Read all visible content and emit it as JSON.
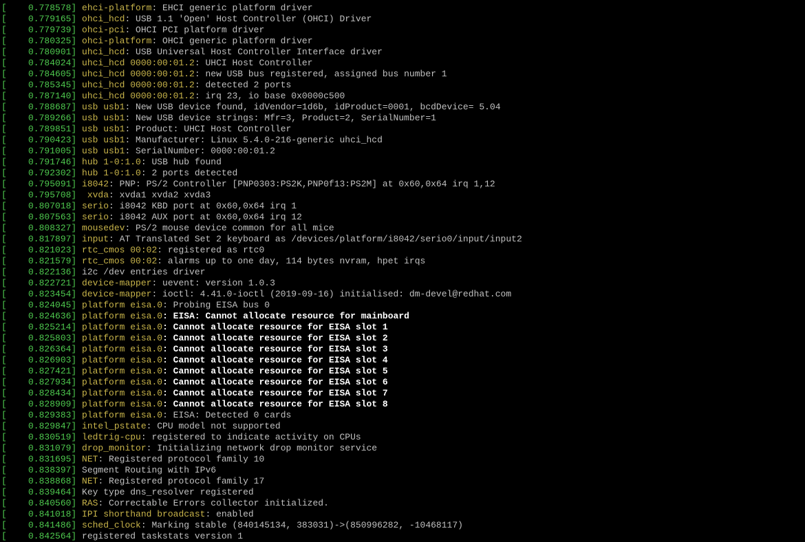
{
  "colors": {
    "background": "#000000",
    "timestamp": "#4ec94e",
    "subsystem": "#c8b44a",
    "message": "#c0c0c0",
    "warning": "#ffffff"
  },
  "lines": [
    {
      "ts": "[    0.778578] ",
      "sub": "ehci-platform",
      "msg": ": EHCI generic platform driver",
      "bold": false
    },
    {
      "ts": "[    0.779165] ",
      "sub": "ohci_hcd",
      "msg": ": USB 1.1 'Open' Host Controller (OHCI) Driver",
      "bold": false
    },
    {
      "ts": "[    0.779739] ",
      "sub": "ohci-pci",
      "msg": ": OHCI PCI platform driver",
      "bold": false
    },
    {
      "ts": "[    0.780325] ",
      "sub": "ohci-platform",
      "msg": ": OHCI generic platform driver",
      "bold": false
    },
    {
      "ts": "[    0.780901] ",
      "sub": "uhci_hcd",
      "msg": ": USB Universal Host Controller Interface driver",
      "bold": false
    },
    {
      "ts": "[    0.784024] ",
      "sub": "uhci_hcd 0000:00:01.2",
      "msg": ": UHCI Host Controller",
      "bold": false
    },
    {
      "ts": "[    0.784605] ",
      "sub": "uhci_hcd 0000:00:01.2",
      "msg": ": new USB bus registered, assigned bus number 1",
      "bold": false
    },
    {
      "ts": "[    0.785345] ",
      "sub": "uhci_hcd 0000:00:01.2",
      "msg": ": detected 2 ports",
      "bold": false
    },
    {
      "ts": "[    0.787140] ",
      "sub": "uhci_hcd 0000:00:01.2",
      "msg": ": irq 23, io base 0x0000c500",
      "bold": false
    },
    {
      "ts": "[    0.788687] ",
      "sub": "usb usb1",
      "msg": ": New USB device found, idVendor=1d6b, idProduct=0001, bcdDevice= 5.04",
      "bold": false
    },
    {
      "ts": "[    0.789266] ",
      "sub": "usb usb1",
      "msg": ": New USB device strings: Mfr=3, Product=2, SerialNumber=1",
      "bold": false
    },
    {
      "ts": "[    0.789851] ",
      "sub": "usb usb1",
      "msg": ": Product: UHCI Host Controller",
      "bold": false
    },
    {
      "ts": "[    0.790423] ",
      "sub": "usb usb1",
      "msg": ": Manufacturer: Linux 5.4.0-216-generic uhci_hcd",
      "bold": false
    },
    {
      "ts": "[    0.791005] ",
      "sub": "usb usb1",
      "msg": ": SerialNumber: 0000:00:01.2",
      "bold": false
    },
    {
      "ts": "[    0.791746] ",
      "sub": "hub 1-0:1.0",
      "msg": ": USB hub found",
      "bold": false
    },
    {
      "ts": "[    0.792302] ",
      "sub": "hub 1-0:1.0",
      "msg": ": 2 ports detected",
      "bold": false
    },
    {
      "ts": "[    0.795091] ",
      "sub": "i8042",
      "msg": ": PNP: PS/2 Controller [PNP0303:PS2K,PNP0f13:PS2M] at 0x60,0x64 irq 1,12",
      "bold": false
    },
    {
      "ts": "[    0.795708] ",
      "sub": " xvda",
      "msg": ": xvda1 xvda2 xvda3",
      "bold": false
    },
    {
      "ts": "[    0.807018] ",
      "sub": "serio",
      "msg": ": i8042 KBD port at 0x60,0x64 irq 1",
      "bold": false
    },
    {
      "ts": "[    0.807563] ",
      "sub": "serio",
      "msg": ": i8042 AUX port at 0x60,0x64 irq 12",
      "bold": false
    },
    {
      "ts": "[    0.808327] ",
      "sub": "mousedev",
      "msg": ": PS/2 mouse device common for all mice",
      "bold": false
    },
    {
      "ts": "[    0.817897] ",
      "sub": "input",
      "msg": ": AT Translated Set 2 keyboard as /devices/platform/i8042/serio0/input/input2",
      "bold": false
    },
    {
      "ts": "[    0.821023] ",
      "sub": "rtc_cmos 00:02",
      "msg": ": registered as rtc0",
      "bold": false
    },
    {
      "ts": "[    0.821579] ",
      "sub": "rtc_cmos 00:02",
      "msg": ": alarms up to one day, 114 bytes nvram, hpet irqs",
      "bold": false
    },
    {
      "ts": "[    0.822136] ",
      "sub": "",
      "msg": "i2c /dev entries driver",
      "bold": false
    },
    {
      "ts": "[    0.822721] ",
      "sub": "device-mapper",
      "msg": ": uevent: version 1.0.3",
      "bold": false
    },
    {
      "ts": "[    0.823454] ",
      "sub": "device-mapper",
      "msg": ": ioctl: 4.41.0-ioctl (2019-09-16) initialised: dm-devel@redhat.com",
      "bold": false
    },
    {
      "ts": "[    0.824045] ",
      "sub": "platform eisa.0",
      "msg": ": Probing EISA bus 0",
      "bold": false
    },
    {
      "ts": "[    0.824636] ",
      "sub": "platform eisa.0",
      "msg": ": EISA: Cannot allocate resource for mainboard",
      "bold": true
    },
    {
      "ts": "[    0.825214] ",
      "sub": "platform eisa.0",
      "msg": ": Cannot allocate resource for EISA slot 1",
      "bold": true
    },
    {
      "ts": "[    0.825803] ",
      "sub": "platform eisa.0",
      "msg": ": Cannot allocate resource for EISA slot 2",
      "bold": true
    },
    {
      "ts": "[    0.826364] ",
      "sub": "platform eisa.0",
      "msg": ": Cannot allocate resource for EISA slot 3",
      "bold": true
    },
    {
      "ts": "[    0.826903] ",
      "sub": "platform eisa.0",
      "msg": ": Cannot allocate resource for EISA slot 4",
      "bold": true
    },
    {
      "ts": "[    0.827421] ",
      "sub": "platform eisa.0",
      "msg": ": Cannot allocate resource for EISA slot 5",
      "bold": true
    },
    {
      "ts": "[    0.827934] ",
      "sub": "platform eisa.0",
      "msg": ": Cannot allocate resource for EISA slot 6",
      "bold": true
    },
    {
      "ts": "[    0.828434] ",
      "sub": "platform eisa.0",
      "msg": ": Cannot allocate resource for EISA slot 7",
      "bold": true
    },
    {
      "ts": "[    0.828909] ",
      "sub": "platform eisa.0",
      "msg": ": Cannot allocate resource for EISA slot 8",
      "bold": true
    },
    {
      "ts": "[    0.829383] ",
      "sub": "platform eisa.0",
      "msg": ": EISA: Detected 0 cards",
      "bold": false
    },
    {
      "ts": "[    0.829847] ",
      "sub": "intel_pstate",
      "msg": ": CPU model not supported",
      "bold": false
    },
    {
      "ts": "[    0.830519] ",
      "sub": "ledtrig-cpu",
      "msg": ": registered to indicate activity on CPUs",
      "bold": false
    },
    {
      "ts": "[    0.831079] ",
      "sub": "drop_monitor",
      "msg": ": Initializing network drop monitor service",
      "bold": false
    },
    {
      "ts": "[    0.831695] ",
      "sub": "NET",
      "msg": ": Registered protocol family 10",
      "bold": false
    },
    {
      "ts": "[    0.838397] ",
      "sub": "",
      "msg": "Segment Routing with IPv6",
      "bold": false
    },
    {
      "ts": "[    0.838868] ",
      "sub": "NET",
      "msg": ": Registered protocol family 17",
      "bold": false
    },
    {
      "ts": "[    0.839464] ",
      "sub": "",
      "msg": "Key type dns_resolver registered",
      "bold": false
    },
    {
      "ts": "[    0.840560] ",
      "sub": "RAS",
      "msg": ": Correctable Errors collector initialized.",
      "bold": false
    },
    {
      "ts": "[    0.841018] ",
      "sub": "IPI shorthand broadcast",
      "msg": ": enabled",
      "bold": false
    },
    {
      "ts": "[    0.841486] ",
      "sub": "sched_clock",
      "msg": ": Marking stable (840145134, 383031)->(850996282, -10468117)",
      "bold": false
    },
    {
      "ts": "[    0.842564] ",
      "sub": "",
      "msg": "registered taskstats version 1",
      "bold": false
    }
  ]
}
